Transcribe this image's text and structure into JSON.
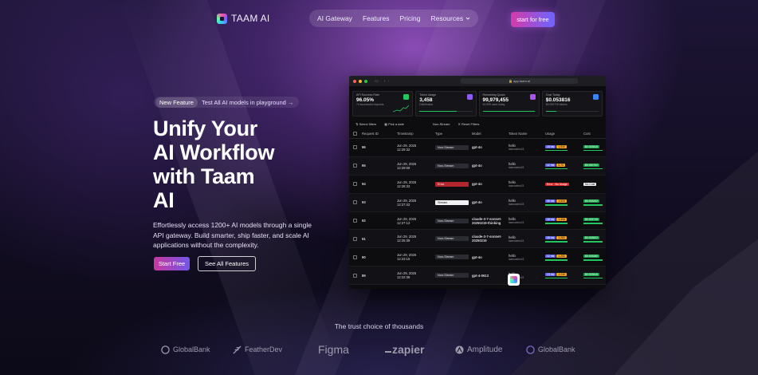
{
  "nav": {
    "brand": "TAAM AI",
    "items": [
      "AI Gateway",
      "Features",
      "Pricing",
      "Resources"
    ],
    "cta": "start for free"
  },
  "hero": {
    "badge": "New Feature",
    "badge_text": "Test All AI models in playground →",
    "headline_lines": [
      "Unify Your",
      "AI Workflow",
      "with Taam",
      "AI"
    ],
    "subtitle": "Effortlessly access 1200+ AI models through a single API gateway. Build smarter, ship faster, and scale AI applications without the complexity.",
    "primary_button": "Start Free",
    "secondary_button": "See All Features"
  },
  "dashboard": {
    "url": "app.taam.ai",
    "cards": [
      {
        "title": "API Success Rate",
        "value": "96.05%",
        "sub": "74 successful requests",
        "icon_color": "#22c55e",
        "fill": 0.96
      },
      {
        "title": "Token Usage",
        "value": "3,458",
        "sub": "Distribution",
        "icon_color": "#8b5cf6",
        "fill": 0.7
      },
      {
        "title": "Remaining Quota",
        "value": "99,979,455",
        "sub": "20,505 used today",
        "icon_color": "#a855f7",
        "fill": 0.99
      },
      {
        "title": "Cost Today",
        "value": "$0.053816",
        "sub": "$0.000715 tokens",
        "icon_color": "#3b82f6",
        "fill": 0.2
      }
    ],
    "filters": [
      "Select filters",
      "Pick a date",
      "Non-Stream",
      "Reset Filters"
    ],
    "columns": [
      "Request ID",
      "Timestamp",
      "Type",
      "Model",
      "Token Name",
      "Usage",
      "Cost"
    ],
    "rows": [
      {
        "id": "96",
        "date": "Jun 29, 2025",
        "time": "12:29:32",
        "type": "Non-Stream",
        "model": "gpt-4o",
        "token": "hello",
        "token_sub": "taamadmin23",
        "usage_a": "15 ms",
        "usage_b": "1,530",
        "cost": "$0.003815"
      },
      {
        "id": "95",
        "date": "Jun 29, 2025",
        "time": "12:29:09",
        "type": "Non-Stream",
        "model": "gpt-4o",
        "token": "hello",
        "token_sub": "taamadmin23",
        "usage_a": "12 ms",
        "usage_b": "5,70",
        "cost": "$0.000702"
      },
      {
        "id": "94",
        "date": "Jun 29, 2025",
        "time": "12:28:33",
        "type": "Error",
        "model": "gpt-4o",
        "token": "hello",
        "token_sub": "taamadmin23",
        "usage_a": "Error · No Usage",
        "usage_b": "",
        "cost": "No Cost"
      },
      {
        "id": "93",
        "date": "Jun 29, 2025",
        "time": "12:27:42",
        "type": "Stream",
        "model": "gpt-4o",
        "token": "hello",
        "token_sub": "taamadmin23",
        "usage_a": "35 ms",
        "usage_b": "1,533",
        "cost": "$0.003202"
      },
      {
        "id": "92",
        "date": "Jun 29, 2025",
        "time": "12:27:12",
        "type": "Non-Stream",
        "model": "claude-3-7-sonnet-20250219-thinking",
        "token": "hello",
        "token_sub": "taamadmin23",
        "usage_a": "18 ms",
        "usage_b": "1,408",
        "cost": "$0.003719"
      },
      {
        "id": "91",
        "date": "Jun 29, 2025",
        "time": "12:25:39",
        "type": "Non-Stream",
        "model": "claude-3-7-sonnet-20250219",
        "token": "hello",
        "token_sub": "taamadmin23",
        "usage_a": "15 ms",
        "usage_b": "1,282",
        "cost": "$0.003822"
      },
      {
        "id": "90",
        "date": "Jun 29, 2025",
        "time": "12:23:15",
        "type": "Non-Stream",
        "model": "gpt-4o",
        "token": "hello",
        "token_sub": "taamadmin23",
        "usage_a": "12 ms",
        "usage_b": "1,282",
        "cost": "$0.003282"
      },
      {
        "id": "89",
        "date": "Jun 29, 2025",
        "time": "12:22:36",
        "type": "Non-Stream",
        "model": "gpt-4-0613",
        "token": "hello",
        "token_sub": "taamadmin23",
        "usage_a": "13 ms",
        "usage_b": "1,230",
        "cost": "$0.003816"
      }
    ]
  },
  "trust": {
    "title": "The trust choice of thousands",
    "logos": [
      "GlobalBank",
      "FeatherDev",
      "Figma",
      "zapier",
      "Amplitude",
      "GlobalBank"
    ]
  }
}
